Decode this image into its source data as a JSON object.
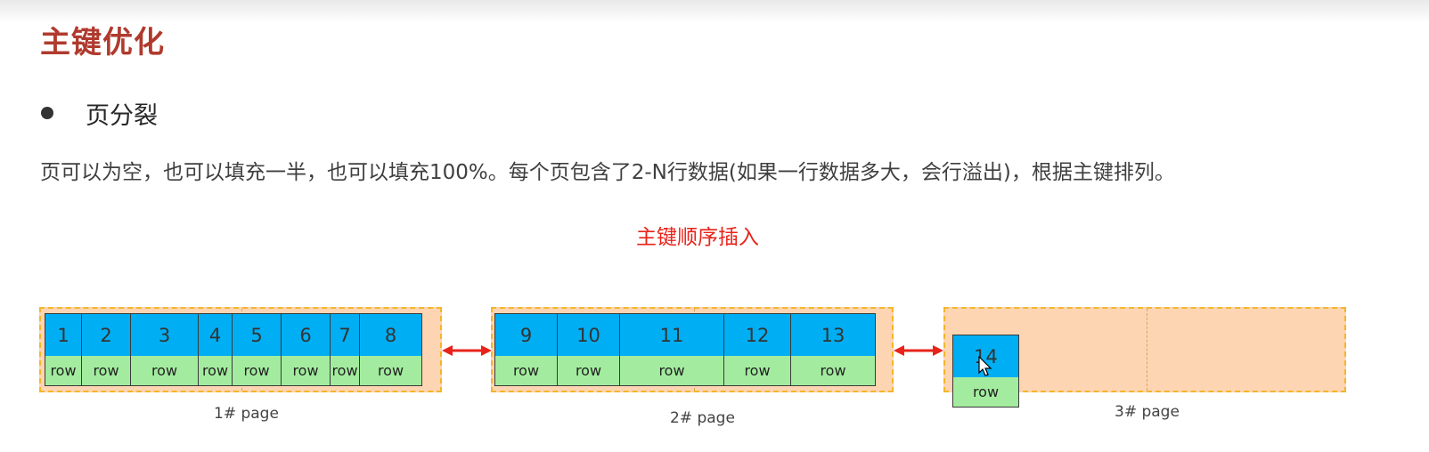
{
  "title": "主键优化",
  "bullet": "页分裂",
  "description": "页可以为空，也可以填充一半，也可以填充100%。每个页包含了2-N行数据(如果一行数据多大，会行溢出)，根据主键排列。",
  "subtitle": "主键顺序插入",
  "colors": {
    "title": "#b03a2e",
    "subtitle": "#e8231a",
    "page_fill": "#fdd5b2",
    "page_border": "#f5b52a",
    "key_fill": "#00aef3",
    "row_fill": "#a3ec9f",
    "arrow": "#e8231a"
  },
  "pages": [
    {
      "label": "1#  page",
      "records": [
        {
          "key": "1",
          "row": "row"
        },
        {
          "key": "2",
          "row": "row"
        },
        {
          "key": "3",
          "row": "row"
        },
        {
          "key": "4",
          "row": "row"
        },
        {
          "key": "5",
          "row": "row"
        },
        {
          "key": "6",
          "row": "row"
        },
        {
          "key": "7",
          "row": "row"
        },
        {
          "key": "8",
          "row": "row"
        }
      ]
    },
    {
      "label": "2#  page",
      "records": [
        {
          "key": "9",
          "row": "row"
        },
        {
          "key": "10",
          "row": "row"
        },
        {
          "key": "11",
          "row": "row"
        },
        {
          "key": "12",
          "row": "row"
        },
        {
          "key": "13",
          "row": "row"
        }
      ]
    },
    {
      "label": "3#  page",
      "records": [
        {
          "key": "14",
          "row": "row"
        }
      ]
    }
  ],
  "icons": {
    "bullet": "bullet-dot-icon",
    "link_arrow": "double-arrow-icon",
    "cursor": "mouse-cursor-icon"
  }
}
